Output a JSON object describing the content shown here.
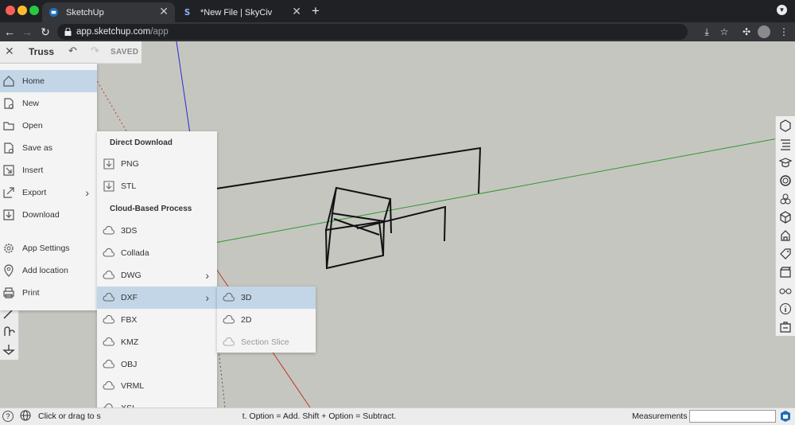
{
  "browser": {
    "tabs": [
      {
        "title": "SketchUp",
        "active": true
      },
      {
        "title": "*New File | SkyCiv",
        "active": false
      }
    ],
    "url_host": "app.sketchup.com",
    "url_path": "/app",
    "new_tab": "+"
  },
  "document": {
    "name": "Truss",
    "status": "SAVED"
  },
  "main_menu": {
    "items": [
      {
        "label": "Home",
        "icon": "home-icon"
      },
      {
        "label": "New",
        "icon": "new-file-icon"
      },
      {
        "label": "Open",
        "icon": "folder-icon"
      },
      {
        "label": "Save as",
        "icon": "save-as-icon"
      },
      {
        "label": "Insert",
        "icon": "insert-icon"
      },
      {
        "label": "Export",
        "icon": "export-icon"
      },
      {
        "label": "Download",
        "icon": "download-icon"
      },
      {
        "label": "App Settings",
        "icon": "gear-icon"
      },
      {
        "label": "Add location",
        "icon": "location-pin-icon"
      },
      {
        "label": "Print",
        "icon": "printer-icon"
      }
    ]
  },
  "export_menu": {
    "direct_header": "Direct Download",
    "direct_items": [
      "PNG",
      "STL"
    ],
    "cloud_header": "Cloud-Based Process",
    "cloud_items": [
      "3DS",
      "Collada",
      "DWG",
      "DXF",
      "FBX",
      "KMZ",
      "OBJ",
      "VRML",
      "XSI"
    ]
  },
  "dxf_menu": {
    "items": [
      {
        "label": "3D",
        "enabled": true
      },
      {
        "label": "2D",
        "enabled": true
      },
      {
        "label": "Section Slice",
        "enabled": false
      }
    ]
  },
  "status_bar": {
    "hint": "Click or drag to s",
    "hint_tail": "t. Option = Add. Shift + Option = Subtract.",
    "measurements_label": "Measurements",
    "measurements_value": ""
  },
  "colors": {
    "accent_selected": "#c2d6e8",
    "canvas": "#c6c6c1",
    "axis_green": "#2e9a2e",
    "axis_red": "#c0392b",
    "axis_blue": "#2a2ad0"
  }
}
